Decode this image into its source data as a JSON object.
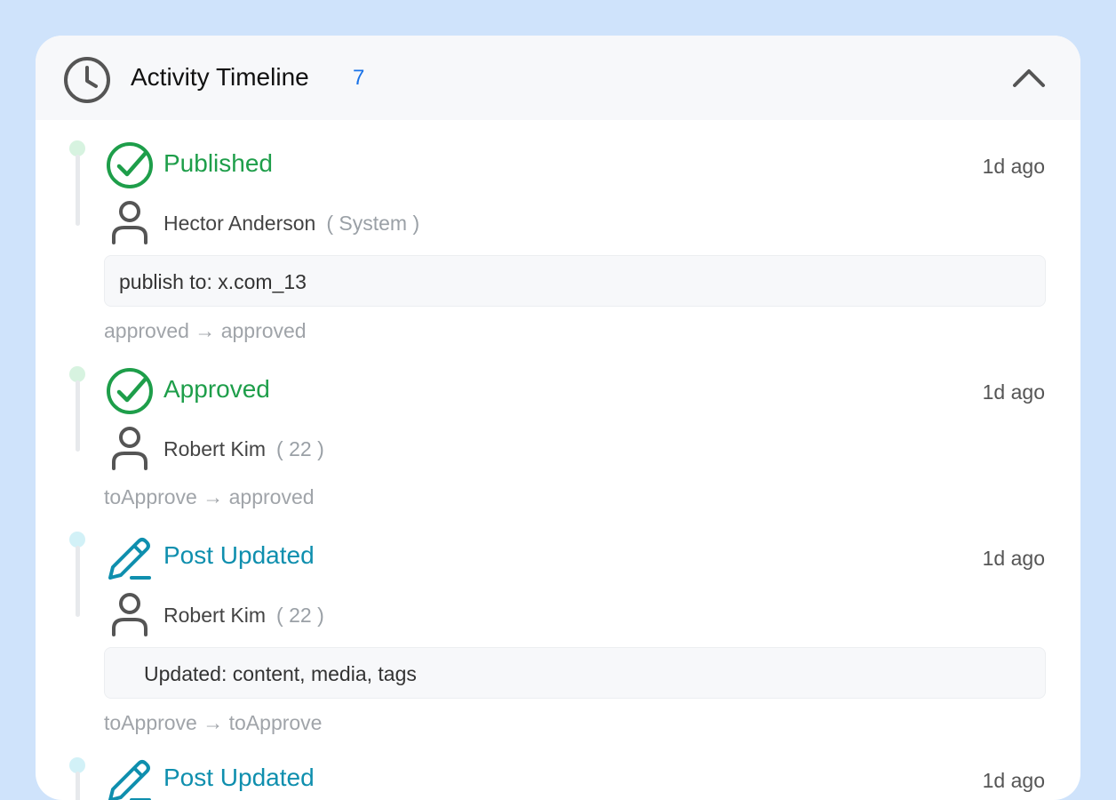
{
  "header": {
    "title": "Activity Timeline",
    "count": "7",
    "icon": "clock-icon",
    "collapse_icon": "chevron-up-icon"
  },
  "colors": {
    "background": "#cfe3fb",
    "published_green": "#1e9e4a",
    "updated_teal": "#0f8fae",
    "count_blue": "#1a73e8"
  },
  "entries": [
    {
      "title": "Published",
      "time": "1d ago",
      "icon": "check-circle-icon",
      "user": "Hector Anderson",
      "user_meta": "( System )",
      "note": "publish to: x.com_13",
      "transition": "approved → approved"
    },
    {
      "title": "Approved",
      "time": "1d ago",
      "icon": "check-circle-icon",
      "user": "Robert Kim",
      "user_meta": "( 22 )",
      "transition": "toApprove → approved"
    },
    {
      "title": "Post Updated",
      "time": "1d ago",
      "icon": "pencil-icon",
      "user": "Robert Kim",
      "user_meta": "( 22 )",
      "note": "Updated: content, media, tags",
      "transition": "toApprove → toApprove"
    },
    {
      "title": "Post Updated",
      "time": "1d ago",
      "icon": "pencil-icon"
    }
  ]
}
